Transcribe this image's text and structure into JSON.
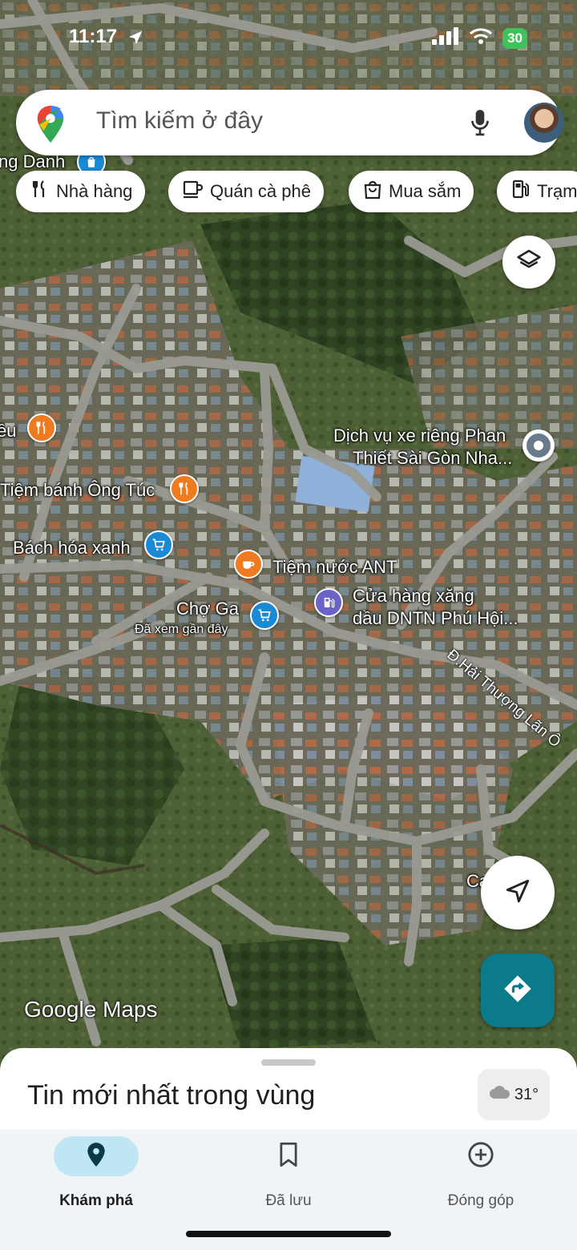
{
  "status_bar": {
    "time": "11:17",
    "battery": "30"
  },
  "search": {
    "placeholder": "Tìm kiếm ở đây"
  },
  "chips": [
    {
      "label": "Nhà hàng",
      "icon": "fork-knife-icon"
    },
    {
      "label": "Quán cà phê",
      "icon": "coffee-icon"
    },
    {
      "label": "Mua sắm",
      "icon": "shopping-bag-icon"
    },
    {
      "label": "Trạm",
      "icon": "gas-pump-icon"
    }
  ],
  "map": {
    "labels": {
      "top_partial": "ng Danh",
      "left_partial": "ều",
      "tiem_banh": "Tiệm bánh Ông Túc",
      "bach_hoa": "Bách hóa xanh",
      "tiem_nuoc": "Tiệm nước ANT",
      "cho_ga": "Chợ Ga",
      "cho_ga_sub": "Đã xem gần đây",
      "cua_hang_1": "Cửa hàng xăng",
      "cua_hang_2": "dầu DNTN Phú Hội...",
      "dich_vu_1": "Dịch vụ xe riêng Phan",
      "dich_vu_2": "Thiết Sài Gòn Nha...",
      "street": "Đ.Hải Thượng Lãn Ô",
      "bottom_right_partial": "Ca"
    },
    "attribution": "Google Maps"
  },
  "sheet": {
    "title": "Tin mới nhất trong vùng",
    "temperature": "31°"
  },
  "nav": [
    {
      "label": "Khám phá",
      "icon": "location-pin-icon",
      "active": true
    },
    {
      "label": "Đã lưu",
      "icon": "bookmark-icon",
      "active": false
    },
    {
      "label": "Đóng góp",
      "icon": "add-circle-icon",
      "active": false
    }
  ],
  "colors": {
    "accent_teal": "#0b7a8a",
    "active_nav_bg": "#bfe6f3",
    "battery_green": "#3fc25a"
  }
}
